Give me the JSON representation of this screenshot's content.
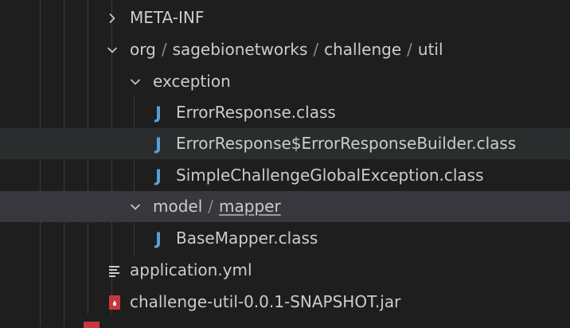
{
  "explorer": {
    "tree": {
      "meta_inf": {
        "label": "META-INF"
      },
      "package_path": {
        "segments": [
          "org",
          "sagebionetworks",
          "challenge",
          "util"
        ]
      },
      "exception_folder": {
        "label": "exception"
      },
      "files_exception": [
        {
          "label": "ErrorResponse.class",
          "icon": "java-class-icon"
        },
        {
          "label": "ErrorResponse$ErrorResponseBuilder.class",
          "icon": "java-class-icon"
        },
        {
          "label": "SimpleChallengeGlobalException.class",
          "icon": "java-class-icon"
        }
      ],
      "model_path": {
        "segments": [
          "model",
          "mapper"
        ]
      },
      "files_model": [
        {
          "label": "BaseMapper.class",
          "icon": "java-class-icon"
        }
      ],
      "application_yml": {
        "label": "application.yml",
        "icon": "yaml-lines-icon"
      },
      "jar_file": {
        "label": "challenge-util-0.0.1-SNAPSHOT.jar",
        "icon": "jar-archive-icon"
      }
    }
  },
  "colors": {
    "background": "#1e1e1e",
    "hover_row": "#2a2d2e",
    "selected_row": "#37373d",
    "text": "#cccccc",
    "java_icon": "#5a9fd4",
    "jar_icon": "#c7373d"
  }
}
